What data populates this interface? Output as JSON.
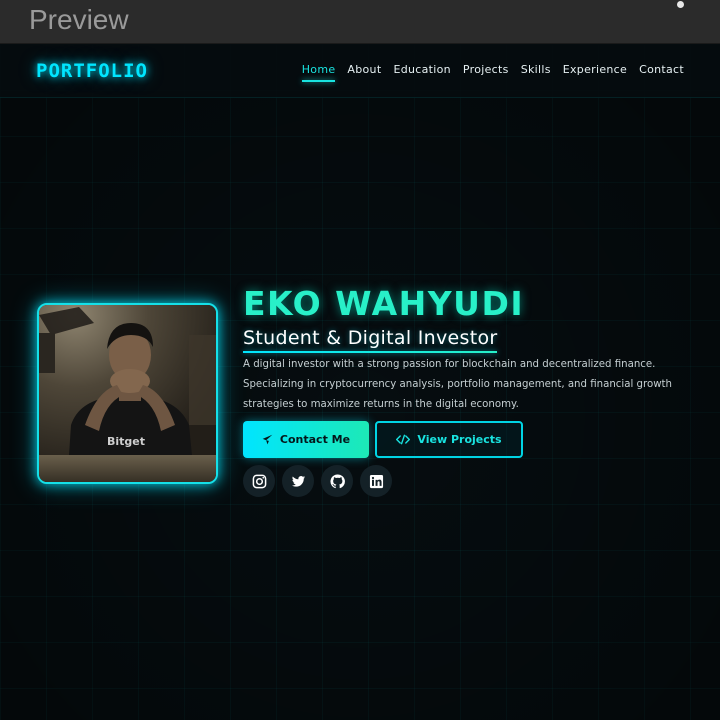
{
  "preview": {
    "title": "Preview"
  },
  "nav": {
    "logo": "PORTFOLIO",
    "links": [
      "Home",
      "About",
      "Education",
      "Projects",
      "Skills",
      "Experience",
      "Contact"
    ],
    "active": "Home"
  },
  "hero": {
    "name": "EKO WAHYUDI",
    "role": "Student & Digital Investor",
    "description": "A digital investor with a strong passion for blockchain and decentralized finance. Specializing in cryptocurrency analysis, portfolio management, and financial growth strategies to maximize returns in the digital economy.",
    "buttons": {
      "contact": "Contact Me",
      "projects": "View Projects"
    },
    "photo_shirt_text": "Bitget"
  },
  "socials": [
    {
      "name": "instagram-icon"
    },
    {
      "name": "twitter-icon"
    },
    {
      "name": "github-icon"
    },
    {
      "name": "linkedin-icon"
    }
  ],
  "colors": {
    "accent": "#00e5ff",
    "accent_green": "#1de9b6",
    "background": "#060d10"
  }
}
